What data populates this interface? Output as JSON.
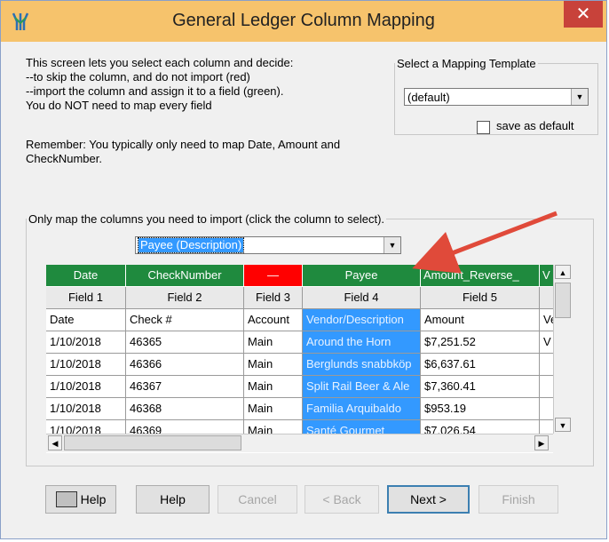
{
  "window": {
    "title": "General Ledger Column Mapping",
    "close": "✕"
  },
  "instructions": [
    "This screen lets you select each column and decide:",
    "--to skip the column, and do not import (red)",
    "--import the column and assign it to a field (green).",
    "You do NOT need to map every field"
  ],
  "reminder": "Remember:  You typically only need to map Date, Amount and CheckNumber.",
  "template": {
    "legend": "Select a Mapping Template",
    "selected": "(default)",
    "save_label": "save as default"
  },
  "mapping": {
    "legend": "Only map the columns you need to import (click the column to select).",
    "field_selected": "Payee (Description)"
  },
  "grid": {
    "header": [
      "Date",
      "CheckNumber",
      "—",
      "Payee",
      "Amount_Reverse_",
      "V"
    ],
    "fields": [
      "Field 1",
      "Field 2",
      "Field 3",
      "Field 4",
      "Field 5",
      ""
    ],
    "rows": [
      [
        "Date",
        "Check #",
        "Account",
        "Vendor/Description",
        "Amount",
        "Ve"
      ],
      [
        "1/10/2018",
        "46365",
        "Main",
        "Around the Horn",
        "$7,251.52",
        "V"
      ],
      [
        "1/10/2018",
        "46366",
        "Main",
        "Berglunds snabbköp",
        "$6,637.61",
        ""
      ],
      [
        "1/10/2018",
        "46367",
        "Main",
        "Split Rail Beer & Ale",
        "$7,360.41",
        ""
      ],
      [
        "1/10/2018",
        "46368",
        "Main",
        "Familia Arquibaldo",
        "$953.19",
        ""
      ],
      [
        "1/10/2018",
        "46369",
        "Main",
        "Santé Gourmet",
        "$7,026.54",
        ""
      ]
    ]
  },
  "buttons": {
    "help_icon": "Help",
    "help": "Help",
    "cancel": "Cancel",
    "back": "< Back",
    "next": "Next >",
    "finish": "Finish"
  },
  "colors": {
    "mapped": "#1f8a3e",
    "skipped": "#ff0000",
    "selected": "#3399ff",
    "arrow": "#e04a3a"
  }
}
